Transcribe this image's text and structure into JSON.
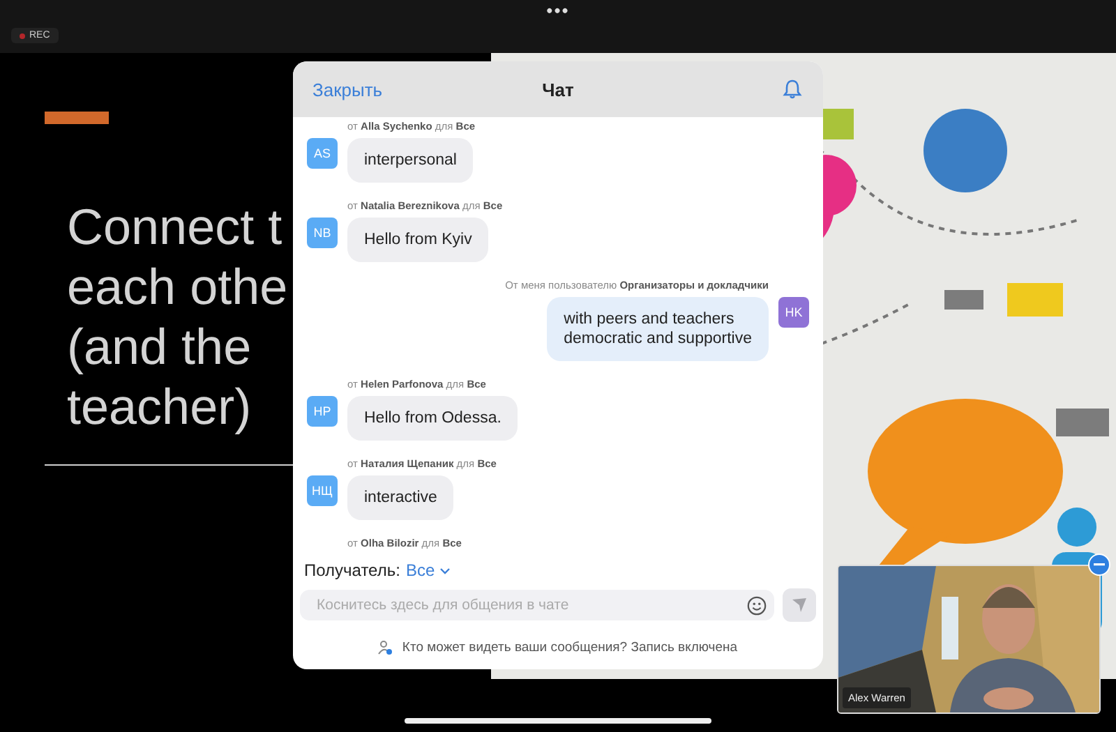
{
  "top_bar": {
    "more": "•••",
    "recording": "REC"
  },
  "slide": {
    "lines": [
      "Connect t",
      "each othe",
      "(and the",
      "teacher)"
    ]
  },
  "chat": {
    "close": "Закрыть",
    "title": "Чат",
    "messages": [
      {
        "meta": "от **Alla Sychenko** для **Все**",
        "initials": "AS",
        "color": "#5aabf5",
        "text": "interpersonal",
        "own": false
      },
      {
        "meta": "от **Natalia Bereznikova** для **Все**",
        "initials": "NB",
        "color": "#5aabf5",
        "text": "Hello from Kyiv",
        "own": false
      },
      {
        "meta": "От меня пользователю **Организаторы и докладчики**",
        "initials": "HK",
        "color": "#8f72d6",
        "text": "with peers and teachers\ndemocratic and supportive",
        "own": true
      },
      {
        "meta": "от **Helen Parfonova** для **Все**",
        "initials": "HP",
        "color": "#5aabf5",
        "text": "Hello from Odessa.",
        "own": false
      },
      {
        "meta": "от **Наталия Щепаник** для **Все**",
        "initials": "НЩ",
        "color": "#5aabf5",
        "text": "interactive",
        "own": false
      },
      {
        "meta": "от **Olha Bilozir** для **Все**",
        "own": false
      }
    ],
    "recipient": {
      "label": "Получатель:",
      "value": "Все"
    },
    "input": {
      "placeholder": "Коснитесь здесь для общения в чате"
    },
    "notice": "Кто может видеть ваши сообщения? Запись включена"
  },
  "video": {
    "name": "Alex Warren"
  }
}
